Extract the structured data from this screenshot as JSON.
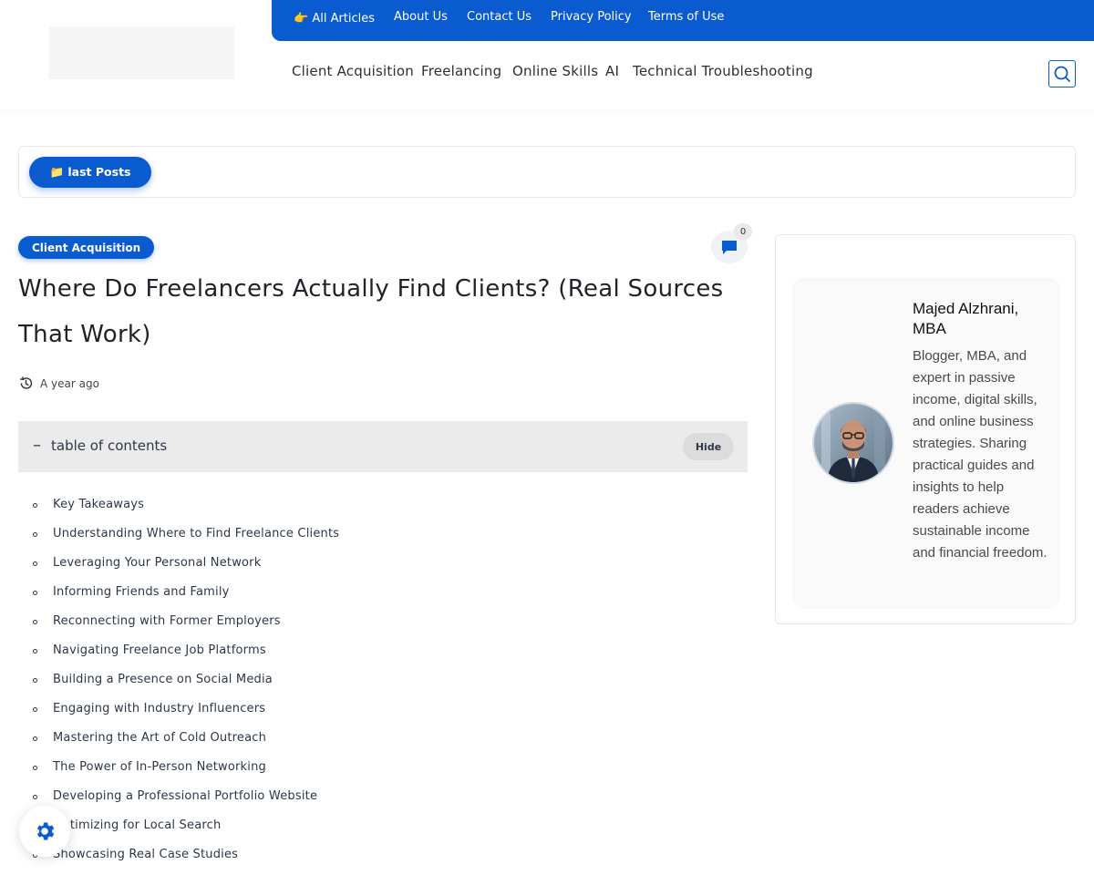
{
  "topbar": {
    "items": [
      {
        "label": "👉 All Articles"
      },
      {
        "label": "About Us"
      },
      {
        "label": "Contact Us"
      },
      {
        "label": "Privacy Policy"
      },
      {
        "label": "Terms of Use"
      }
    ]
  },
  "mainnav": {
    "items": [
      {
        "label": "Client Acquisition"
      },
      {
        "label": "Freelancing"
      },
      {
        "label": "Online Skills"
      },
      {
        "label": "AI"
      },
      {
        "label": "Technical Troubleshooting"
      }
    ]
  },
  "lastposts": {
    "label": "📁 last Posts"
  },
  "article": {
    "category": "Client Acquisition",
    "comment_count": "0",
    "title": "Where Do Freelancers Actually Find Clients? (Real Sources That Work)",
    "date": "A year ago"
  },
  "toc": {
    "toggle": "–",
    "title": "table of contents",
    "hide_label": "Hide",
    "items": [
      "Key Takeaways",
      "Understanding Where to Find Freelance Clients",
      "Leveraging Your Personal Network",
      "Informing Friends and Family",
      "Reconnecting with Former Employers",
      "Navigating Freelance Job Platforms",
      "Building a Presence on Social Media",
      "Engaging with Industry Influencers",
      "Mastering the Art of Cold Outreach",
      "The Power of In-Person Networking",
      "Developing a Professional Portfolio Website",
      "Optimizing for Local Search",
      "Showcasing Real Case Studies"
    ]
  },
  "author": {
    "name": "Majed Alzhrani, MBA",
    "bio": "Blogger, MBA, and expert in passive income, digital skills, and online business strategies. Sharing practical guides and insights to help readers achieve sustainable income and financial freedom."
  },
  "colors": {
    "accent": "#0a5bd0",
    "toc_bg": "#ebebeb"
  },
  "icons": [
    "search-icon",
    "comment-icon",
    "history-icon",
    "gear-icon"
  ]
}
